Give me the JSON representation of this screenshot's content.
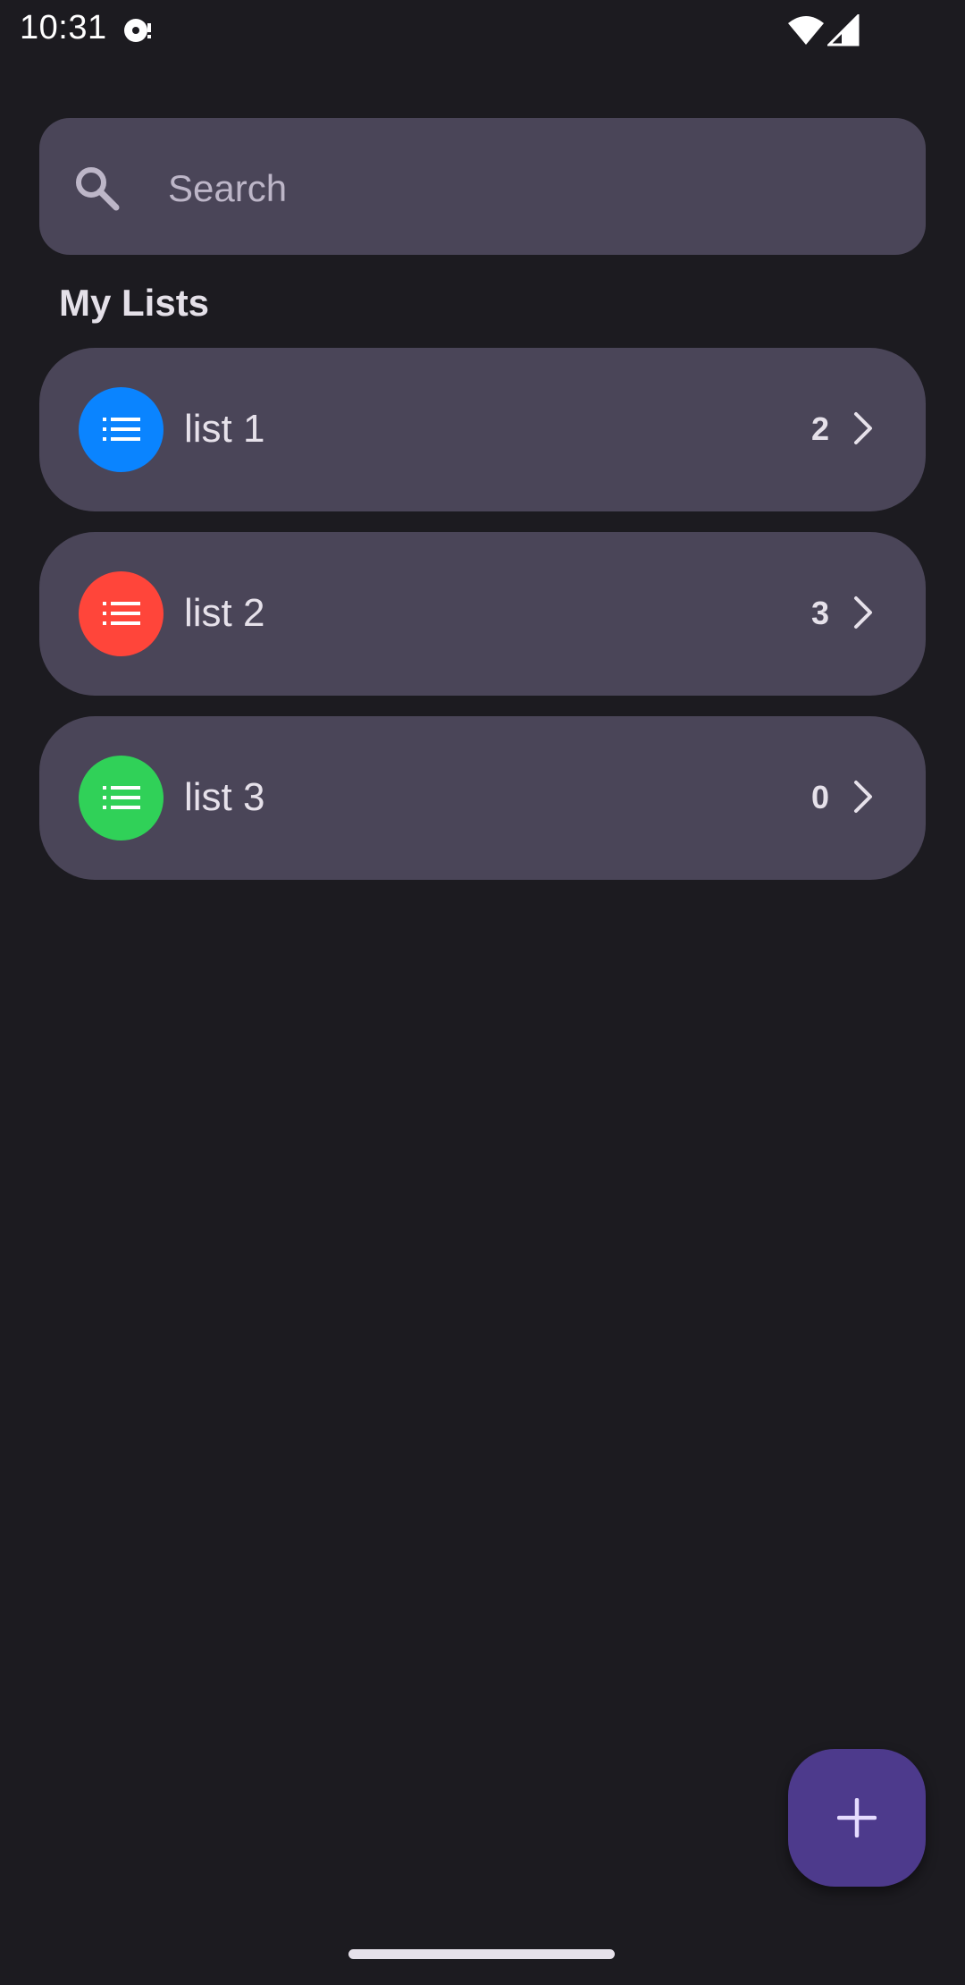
{
  "status_bar": {
    "time": "10:31"
  },
  "search": {
    "placeholder": "Search"
  },
  "section": {
    "title": "My Lists"
  },
  "lists": [
    {
      "name": "list 1",
      "count": "2",
      "color": "#0a84ff",
      "icon": "list-bullet-icon"
    },
    {
      "name": "list 2",
      "count": "3",
      "color": "#ff453a",
      "icon": "list-bullet-icon"
    },
    {
      "name": "list 3",
      "count": "0",
      "color": "#30d158",
      "icon": "list-bullet-icon"
    }
  ],
  "fab": {
    "icon": "plus-icon",
    "color": "#4d3a8c"
  },
  "colors": {
    "background": "#1c1b20",
    "card": "#4a4558"
  }
}
